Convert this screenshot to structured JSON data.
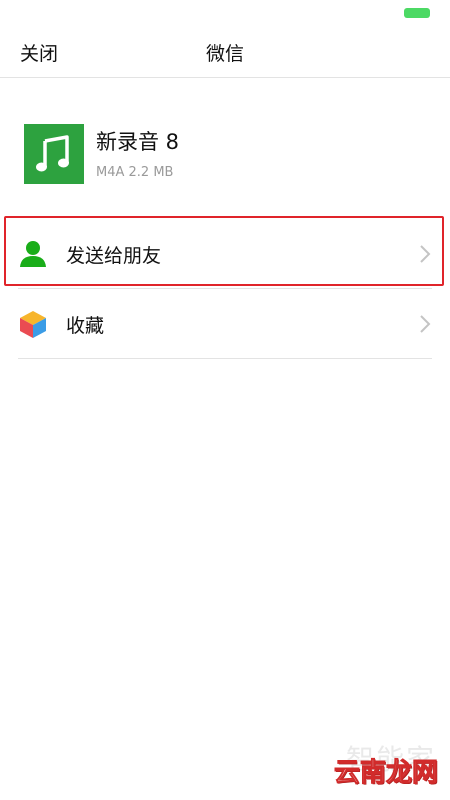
{
  "status_bar": {
    "battery_color": "#4cd964"
  },
  "nav": {
    "close_label": "关闭",
    "title": "微信"
  },
  "file": {
    "name": "新录音 8",
    "meta": "M4A 2.2 MB",
    "thumb_color": "#2da23f",
    "icon": "music-note-icon"
  },
  "menu": [
    {
      "label": "发送给朋友",
      "icon": "person-icon",
      "icon_color": "#1aad19"
    },
    {
      "label": "收藏",
      "icon": "cube-icon"
    }
  ],
  "highlight_color": "#e0242a",
  "watermark": {
    "line1": "智能家",
    "line2": "云南龙网"
  }
}
